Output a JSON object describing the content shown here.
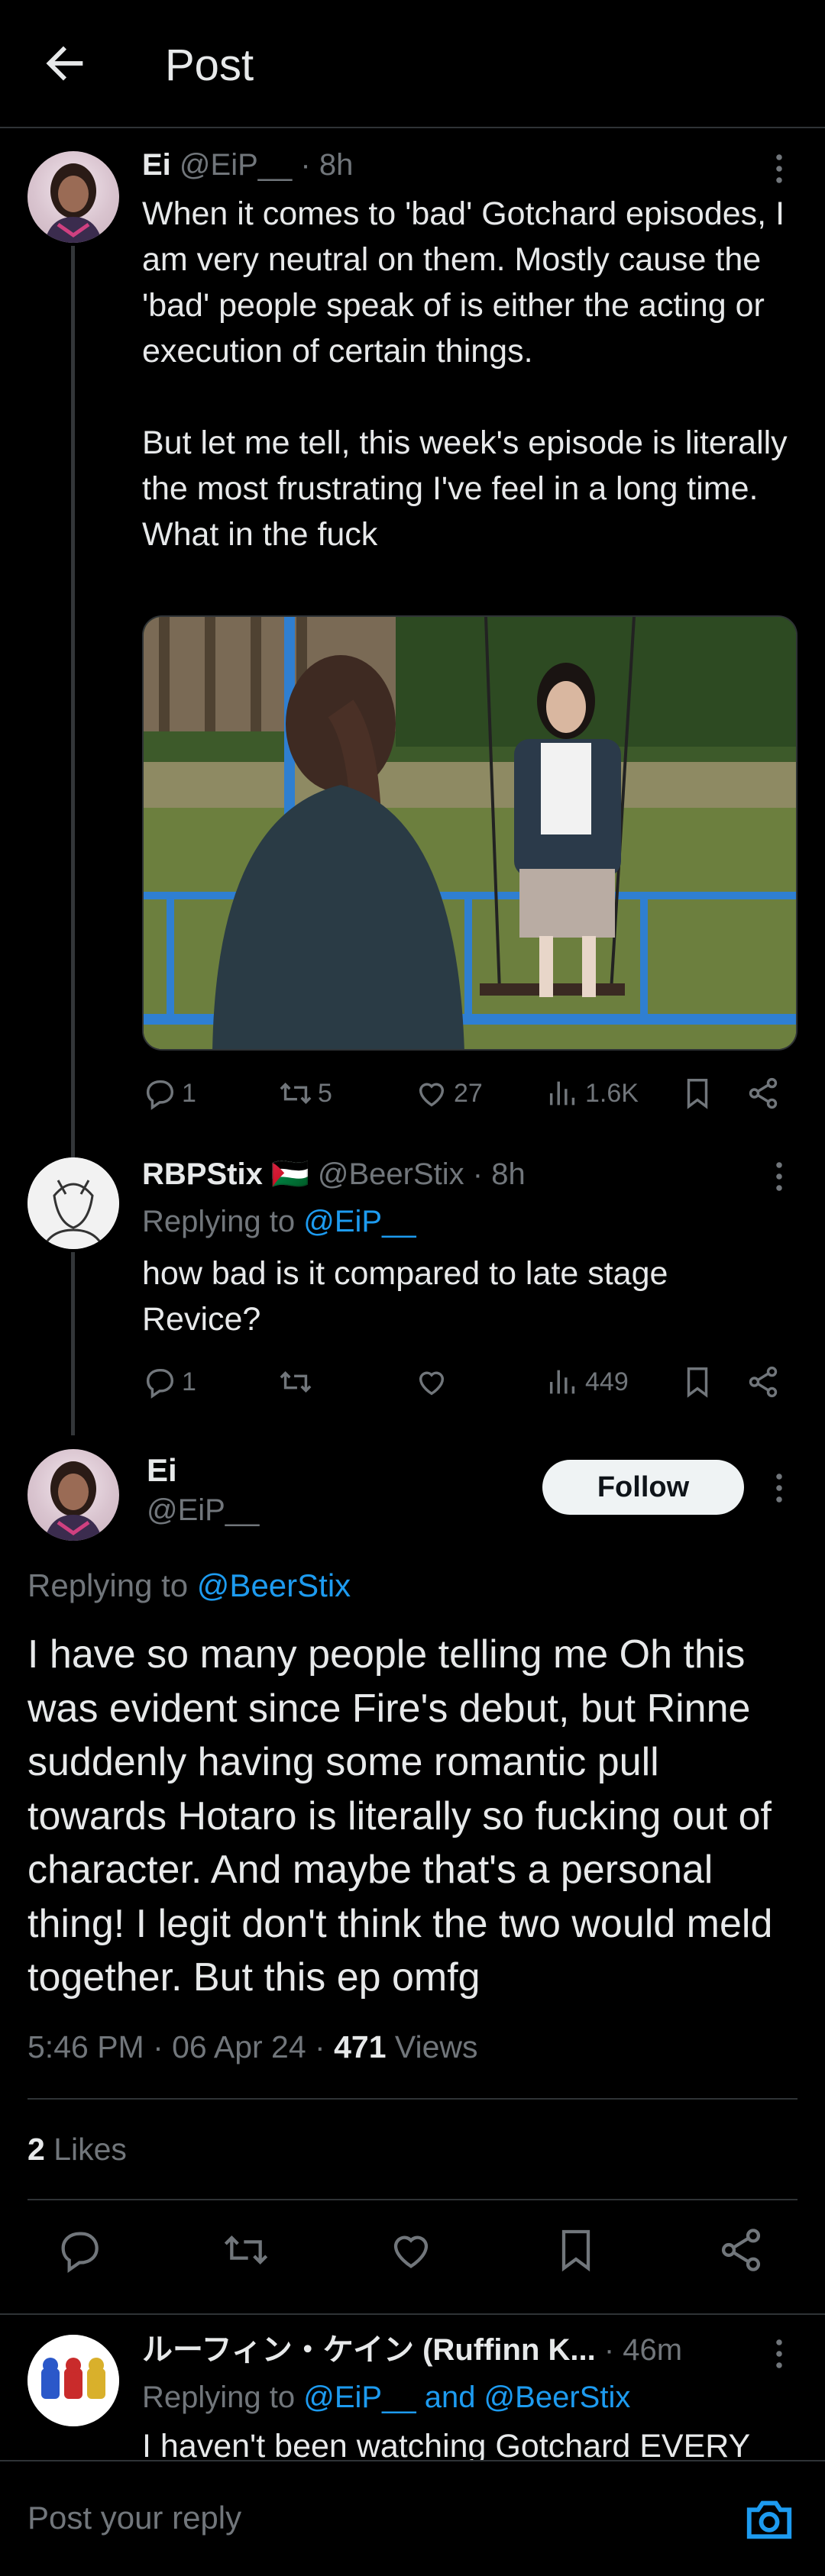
{
  "header": {
    "title": "Post"
  },
  "tweet1": {
    "name": "Ei",
    "handle": "@EiP__",
    "time": "· 8h",
    "text": "When it comes to 'bad' Gotchard episodes, I am very neutral on them. Mostly cause the 'bad' people speak of is either the acting or execution of certain things.\n\nBut let me tell, this week's episode is literally the most frustrating I've feel in a long time. What in the fuck",
    "replies": "1",
    "reposts": "5",
    "likes": "27",
    "views": "1.6K"
  },
  "tweet2": {
    "name": "RBPStix",
    "flag": "🇵🇸",
    "handle": "@BeerStix",
    "time": "· 8h",
    "replying_label": "Replying to",
    "replying_to": "@EiP__",
    "text": "how bad is it compared to late stage Revice?",
    "replies": "1",
    "reposts": "",
    "likes": "",
    "views": "449"
  },
  "main_tweet": {
    "name": "Ei",
    "handle": "@EiP__",
    "follow_label": "Follow",
    "replying_label": "Replying to",
    "replying_to": "@BeerStix",
    "text": "I have so many people telling me Oh this was evident since Fire's debut, but Rinne suddenly having some romantic pull towards Hotaro is literally so fucking out of character. And maybe that's a personal thing! I legit don't think the two would meld together. But this ep omfg",
    "time": "5:46 PM · 06 Apr 24 · ",
    "views_count": "471",
    "views_label": " Views",
    "likes_count": "2",
    "likes_label": " Likes"
  },
  "tweet4": {
    "name": "ルーフィン・ケイン (Ruffinn K...",
    "time": "· 46m",
    "replying_label": "Replying to",
    "replying_to": "@EiP__ and @BeerStix",
    "text": "I haven't been watching Gotchard EVERY"
  },
  "reply_bar": {
    "placeholder": "Post your reply"
  },
  "colors": {
    "background": "#000000",
    "text": "#e7e9ea",
    "muted": "#71767b",
    "accent": "#1d9bf0",
    "divider": "#2f3336"
  },
  "icons": [
    "back-arrow-icon",
    "more-icon",
    "reply-icon",
    "repost-icon",
    "like-icon",
    "views-icon",
    "bookmark-icon",
    "share-icon",
    "camera-icon"
  ]
}
